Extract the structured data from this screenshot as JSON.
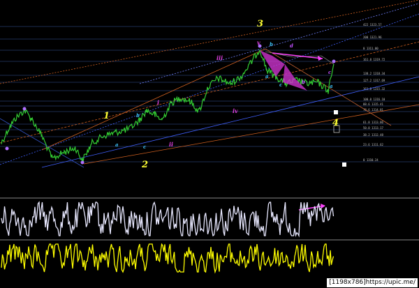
{
  "wave_labels": {
    "impulse": [
      {
        "id": "1",
        "text": "1"
      },
      {
        "id": "2",
        "text": "2"
      },
      {
        "id": "3",
        "text": "3"
      },
      {
        "id": "4",
        "text": "4"
      }
    ],
    "roman": [
      {
        "id": "i",
        "text": "i"
      },
      {
        "id": "ii",
        "text": "ii"
      },
      {
        "id": "iii",
        "text": "iii"
      },
      {
        "id": "iv",
        "text": "iv"
      },
      {
        "id": "v",
        "text": "v"
      }
    ],
    "sub": [
      "a",
      "b",
      "c",
      "a",
      "b",
      "c",
      "a",
      "b",
      "c",
      "d"
    ]
  },
  "fib_levels": [
    "422 1323.57",
    "200 1321.96",
    "0 1311.00",
    "161.8 1319.72",
    "138.2 1318.34",
    "127.2 1317.69",
    "161.8 1315.32",
    "100.0 1316.10",
    "88.6 1315.41",
    "78.6 1314.81",
    "61.8 1313.86",
    "50.0 1313.17",
    "38.2 1312.48",
    "23.6 1311.62",
    "0 1310.24"
  ],
  "colors": {
    "background": "#000000",
    "price_line": "#33cc33",
    "osc1": "#e8e8ff",
    "osc2": "#ffff00",
    "fib_line": "#3a5aa0",
    "wave_main": "#ffff33",
    "wave_roman": "#e040e0",
    "wave_sub": "#40c8ff",
    "arrow": "#ff44ff"
  },
  "watermark": "[1198x786]https://upic.me/"
}
